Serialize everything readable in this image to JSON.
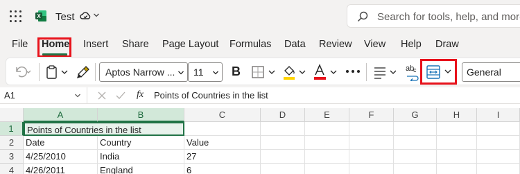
{
  "app": {
    "doc_title": "Test"
  },
  "search": {
    "placeholder": "Search for tools, help, and more (A"
  },
  "tabs": [
    {
      "label": "File"
    },
    {
      "label": "Home",
      "active": true
    },
    {
      "label": "Insert"
    },
    {
      "label": "Share"
    },
    {
      "label": "Page Layout"
    },
    {
      "label": "Formulas"
    },
    {
      "label": "Data"
    },
    {
      "label": "Review"
    },
    {
      "label": "View"
    },
    {
      "label": "Help"
    },
    {
      "label": "Draw"
    }
  ],
  "ribbon": {
    "font_name": "Aptos Narrow ...",
    "font_size": "11",
    "bold_label": "B",
    "number_format": "General",
    "icons": [
      "undo-icon",
      "paste-icon",
      "format-painter-icon",
      "borders-icon",
      "fill-color-icon",
      "font-color-icon",
      "more-icon",
      "align-icon",
      "wrap-text-icon",
      "merge-icon"
    ],
    "fill_color": "#ffd400",
    "font_color": "#e8121b"
  },
  "formula_bar": {
    "name_box": "A1",
    "fx_label": "fx",
    "content": "Points of Countries in the list"
  },
  "grid": {
    "columns": [
      "A",
      "B",
      "C",
      "D",
      "E",
      "F",
      "G",
      "H",
      "I"
    ],
    "rows": [
      "1",
      "2",
      "3",
      "4"
    ],
    "cells": [
      [
        "Points of Countries in the list",
        "",
        ""
      ],
      [
        "Date",
        "Country",
        "Value"
      ],
      [
        "4/25/2010",
        "India",
        "27"
      ],
      [
        "4/26/2011",
        "England",
        "6"
      ]
    ]
  },
  "colors": {
    "accent": "#217346",
    "highlight": "#e8121b"
  }
}
